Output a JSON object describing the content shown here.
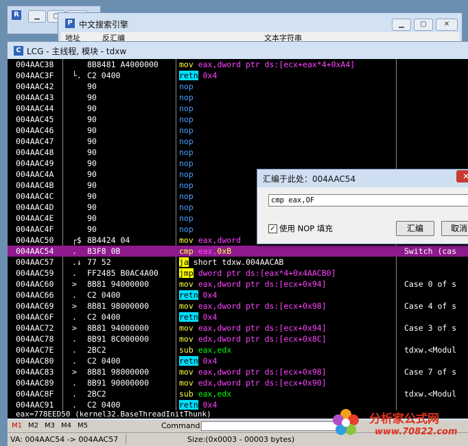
{
  "back_window": {
    "icon": "R"
  },
  "search_window": {
    "icon": "P",
    "title": "中文搜索引擎",
    "columns": [
      "地址",
      "反汇编",
      "文本字符串"
    ]
  },
  "main_window": {
    "icon": "C",
    "title": "LCG - 主线程, 模块 - tdxw"
  },
  "rows": [
    {
      "addr": "004AAC38",
      "mark": "",
      "hex": "8B8481 A4000000",
      "dis": [
        [
          "mov",
          "k"
        ],
        [
          " eax,dword ptr ds:[ecx+eax*4+0xA4]",
          "kr"
        ]
      ],
      "cmt": ""
    },
    {
      "addr": "004AAC3F",
      "mark": "└.",
      "hex": "C2 0400",
      "dis": [
        [
          "retn",
          "hl-c"
        ],
        [
          " 0x4",
          "kr"
        ]
      ],
      "cmt": ""
    },
    {
      "addr": "004AAC42",
      "mark": "",
      "hex": "90",
      "dis": [
        [
          "nop",
          "kn"
        ]
      ],
      "cmt": ""
    },
    {
      "addr": "004AAC43",
      "mark": "",
      "hex": "90",
      "dis": [
        [
          "nop",
          "kn"
        ]
      ],
      "cmt": ""
    },
    {
      "addr": "004AAC44",
      "mark": "",
      "hex": "90",
      "dis": [
        [
          "nop",
          "kn"
        ]
      ],
      "cmt": ""
    },
    {
      "addr": "004AAC45",
      "mark": "",
      "hex": "90",
      "dis": [
        [
          "nop",
          "kn"
        ]
      ],
      "cmt": ""
    },
    {
      "addr": "004AAC46",
      "mark": "",
      "hex": "90",
      "dis": [
        [
          "nop",
          "kn"
        ]
      ],
      "cmt": ""
    },
    {
      "addr": "004AAC47",
      "mark": "",
      "hex": "90",
      "dis": [
        [
          "nop",
          "kn"
        ]
      ],
      "cmt": ""
    },
    {
      "addr": "004AAC48",
      "mark": "",
      "hex": "90",
      "dis": [
        [
          "nop",
          "kn"
        ]
      ],
      "cmt": ""
    },
    {
      "addr": "004AAC49",
      "mark": "",
      "hex": "90",
      "dis": [
        [
          "nop",
          "kn"
        ]
      ],
      "cmt": ""
    },
    {
      "addr": "004AAC4A",
      "mark": "",
      "hex": "90",
      "dis": [
        [
          "nop",
          "kn"
        ]
      ],
      "cmt": ""
    },
    {
      "addr": "004AAC4B",
      "mark": "",
      "hex": "90",
      "dis": [
        [
          "nop",
          "kn"
        ]
      ],
      "cmt": ""
    },
    {
      "addr": "004AAC4C",
      "mark": "",
      "hex": "90",
      "dis": [
        [
          "nop",
          "kn"
        ]
      ],
      "cmt": ""
    },
    {
      "addr": "004AAC4D",
      "mark": "",
      "hex": "90",
      "dis": [
        [
          "nop",
          "kn"
        ]
      ],
      "cmt": ""
    },
    {
      "addr": "004AAC4E",
      "mark": "",
      "hex": "90",
      "dis": [
        [
          "nop",
          "kn"
        ]
      ],
      "cmt": ""
    },
    {
      "addr": "004AAC4F",
      "mark": "",
      "hex": "90",
      "dis": [
        [
          "nop",
          "kn"
        ]
      ],
      "cmt": ""
    },
    {
      "addr": "004AAC50",
      "mark": "┌$",
      "hex": "8B4424 04",
      "dis": [
        [
          "mov",
          "k"
        ],
        [
          " eax,dword",
          "kr"
        ]
      ],
      "cmt": ""
    },
    {
      "addr": "004AAC54",
      "mark": ".",
      "hex": "83F8 0B",
      "dis": [
        [
          "cmp",
          "k"
        ],
        [
          " eax,",
          "kr"
        ],
        [
          "0xB",
          "k"
        ]
      ],
      "cmt": "Switch (cas",
      "sel": true
    },
    {
      "addr": "004AAC57",
      "mark": ".↓",
      "hex": "77 52",
      "dis": [
        [
          "ja",
          "hl-y"
        ],
        [
          " short tdxw.004AACAB",
          "kw"
        ]
      ],
      "cmt": ""
    },
    {
      "addr": "004AAC59",
      "mark": ".",
      "hex": "FF2485 B0AC4A00",
      "dis": [
        [
          "jmp",
          "hl-y"
        ],
        [
          " dword ptr ds:[eax*4+0x4AACB0]",
          "kr"
        ]
      ],
      "cmt": ""
    },
    {
      "addr": "004AAC60",
      "mark": ">",
      "hex": "8B81 94000000",
      "dis": [
        [
          "mov",
          "k"
        ],
        [
          " eax,dword ptr ds:[ecx+0x94]",
          "kr"
        ]
      ],
      "cmt": "Case 0 of s"
    },
    {
      "addr": "004AAC66",
      "mark": ".",
      "hex": "C2 0400",
      "dis": [
        [
          "retn",
          "hl-c"
        ],
        [
          " 0x4",
          "kr"
        ]
      ],
      "cmt": ""
    },
    {
      "addr": "004AAC69",
      "mark": ">",
      "hex": "8B81 98000000",
      "dis": [
        [
          "mov",
          "k"
        ],
        [
          " eax,dword ptr ds:[ecx+0x98]",
          "kr"
        ]
      ],
      "cmt": "Case 4 of s"
    },
    {
      "addr": "004AAC6F",
      "mark": ".",
      "hex": "C2 0400",
      "dis": [
        [
          "retn",
          "hl-c"
        ],
        [
          " 0x4",
          "kr"
        ]
      ],
      "cmt": ""
    },
    {
      "addr": "004AAC72",
      "mark": ">",
      "hex": "8B81 94000000",
      "dis": [
        [
          "mov",
          "k"
        ],
        [
          " eax,dword ptr ds:[ecx+0x94]",
          "kr"
        ]
      ],
      "cmt": "Case 3 of s"
    },
    {
      "addr": "004AAC78",
      "mark": ".",
      "hex": "8B91 8C000000",
      "dis": [
        [
          "mov",
          "k"
        ],
        [
          " edx,dword ptr ds:[ecx+0x8C]",
          "kr"
        ]
      ],
      "cmt": ""
    },
    {
      "addr": "004AAC7E",
      "mark": ".",
      "hex": "2BC2",
      "dis": [
        [
          "sub",
          "k"
        ],
        [
          " eax,edx",
          "kj"
        ]
      ],
      "cmt": "tdxw.<Modul"
    },
    {
      "addr": "004AAC80",
      "mark": ".",
      "hex": "C2 0400",
      "dis": [
        [
          "retn",
          "hl-c"
        ],
        [
          " 0x4",
          "kr"
        ]
      ],
      "cmt": ""
    },
    {
      "addr": "004AAC83",
      "mark": ">",
      "hex": "8B81 98000000",
      "dis": [
        [
          "mov",
          "k"
        ],
        [
          " eax,dword ptr ds:[ecx+0x98]",
          "kr"
        ]
      ],
      "cmt": "Case 7 of s"
    },
    {
      "addr": "004AAC89",
      "mark": ".",
      "hex": "8B91 90000000",
      "dis": [
        [
          "mov",
          "k"
        ],
        [
          " edx,dword ptr ds:[ecx+0x90]",
          "kr"
        ]
      ],
      "cmt": ""
    },
    {
      "addr": "004AAC8F",
      "mark": ".",
      "hex": "2BC2",
      "dis": [
        [
          "sub",
          "k"
        ],
        [
          " eax,edx",
          "kj"
        ]
      ],
      "cmt": "tdxw.<Modul"
    },
    {
      "addr": "004AAC91",
      "mark": ".",
      "hex": "C2 0400",
      "dis": [
        [
          "retn",
          "hl-c"
        ],
        [
          " 0x4",
          "kr"
        ]
      ],
      "cmt": ""
    }
  ],
  "reg_line": "eax=778EED50 (kernel32.BaseThreadInitThunk)",
  "markers": [
    "M1",
    "M2",
    "M3",
    "M4",
    "M5"
  ],
  "command_label": "Command:",
  "status": {
    "va": "VA: 004AAC54 -> 004AAC57",
    "size": "Size:(0x0003 - 00003 bytes)"
  },
  "dialog": {
    "title": "汇编于此处：004AAC54",
    "input_value": "cmp eax,OF",
    "checkbox_label": "使用 NOP 填充",
    "assemble_button": "汇编",
    "cancel_button": "取消"
  },
  "watermark": {
    "line1": "分析家公式网",
    "line2": "www.70822.com"
  },
  "colors": {
    "selection": "#8e1a8e",
    "mnemonic": "#ffff3c",
    "operand": "#ff44ff",
    "nop": "#4aa0ff",
    "jump_bg": "#ffff00",
    "retn_bg": "#00e0ff"
  }
}
